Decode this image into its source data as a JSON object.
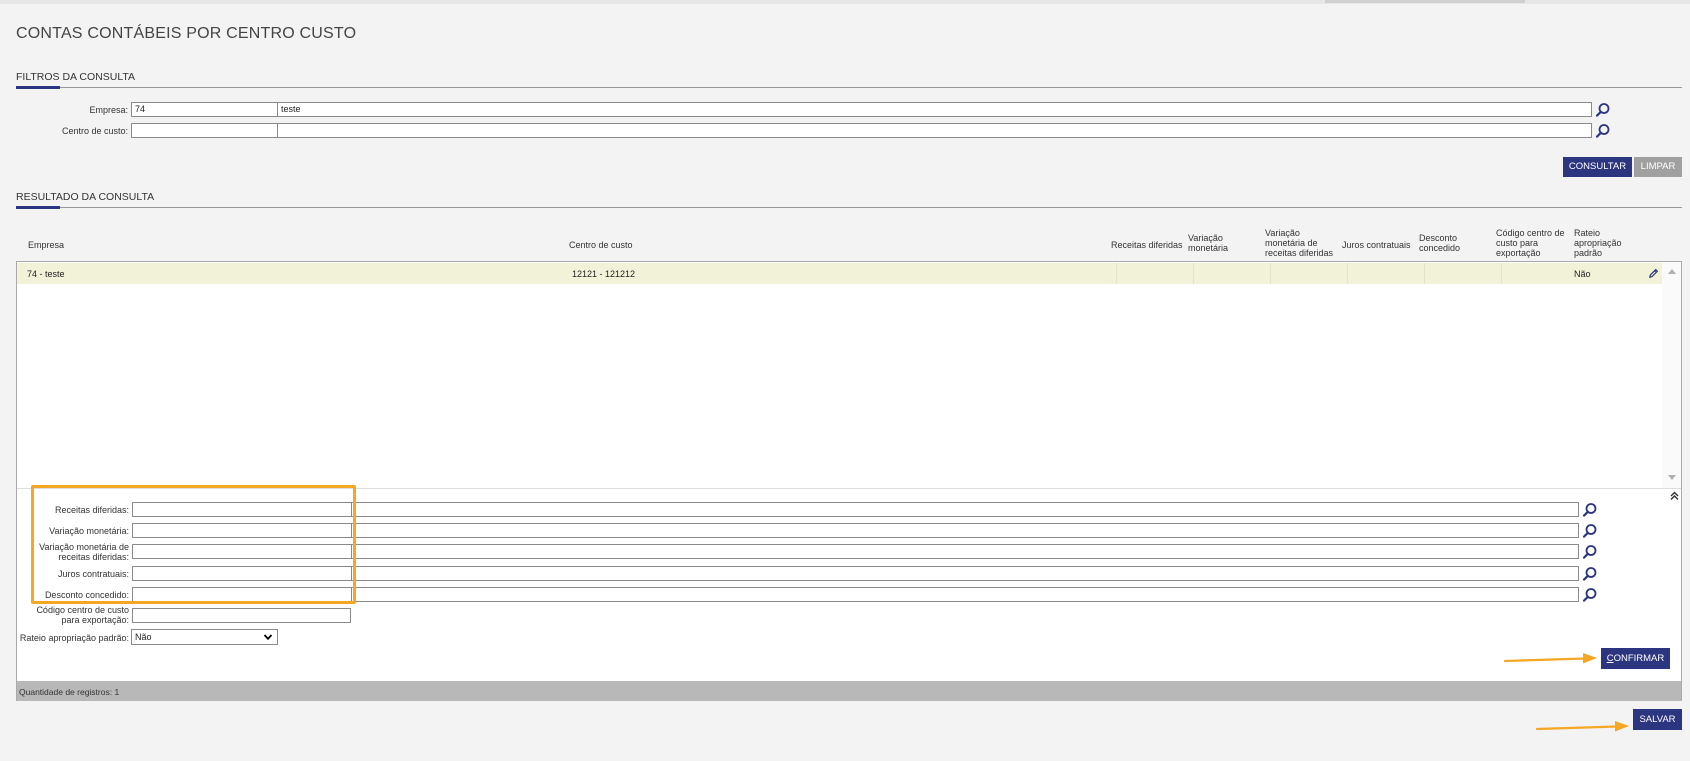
{
  "page": {
    "title": "CONTAS CONTÁBEIS POR CENTRO CUSTO"
  },
  "filters": {
    "section_title": "FILTROS DA CONSULTA",
    "empresa_label": "Empresa:",
    "empresa_code": "74",
    "empresa_name": "teste",
    "centro_label": "Centro de custo:",
    "centro_code": "",
    "centro_name": "",
    "consultar_label": "CONSULTAR",
    "limpar_label": "LIMPAR"
  },
  "results": {
    "section_title": "RESULTADO DA CONSULTA",
    "columns": {
      "empresa": "Empresa",
      "centro": "Centro de custo",
      "receitas": "Receitas diferidas",
      "variacao": [
        "Variação",
        "monetária"
      ],
      "variacao_receitas": [
        "Variação",
        "monetária de",
        "receitas diferidas"
      ],
      "juros": "Juros contratuais",
      "desconto": [
        "Desconto",
        "concedido"
      ],
      "codigo": [
        "Código centro de",
        "custo para",
        "exportação"
      ],
      "rateio": [
        "Rateio",
        "apropriação",
        "padrão"
      ]
    },
    "rows": [
      {
        "empresa": "74 - teste",
        "centro": "12121 - 121212",
        "rateio": "Não"
      }
    ],
    "status": "Quantidade de registros: 1"
  },
  "form": {
    "receitas_label": "Receitas diferidas:",
    "variacao_label": "Variação monetária:",
    "variacao_receitas_label": [
      "Variação monetária de",
      "receitas diferidas:"
    ],
    "juros_label": "Juros contratuais:",
    "desconto_label": "Desconto concedido:",
    "codigo_label": [
      "Código centro de custo",
      "para exportação:"
    ],
    "rateio_label": "Rateio apropriação padrão:",
    "rateio_value": "Não",
    "confirmar_first": "C",
    "confirmar_rest": "ONFIRMAR"
  },
  "footer": {
    "salvar_label": "SALVAR"
  },
  "colors": {
    "primary": "#2c3580",
    "highlight": "#f5a623",
    "row_selected": "#f2f2d8"
  },
  "icons": [
    "search-icon",
    "edit-icon",
    "chevron-up-icon",
    "chevron-down-icon",
    "double-chevron-up-icon",
    "dropdown-chevron-icon",
    "arrow-right-annotation"
  ]
}
